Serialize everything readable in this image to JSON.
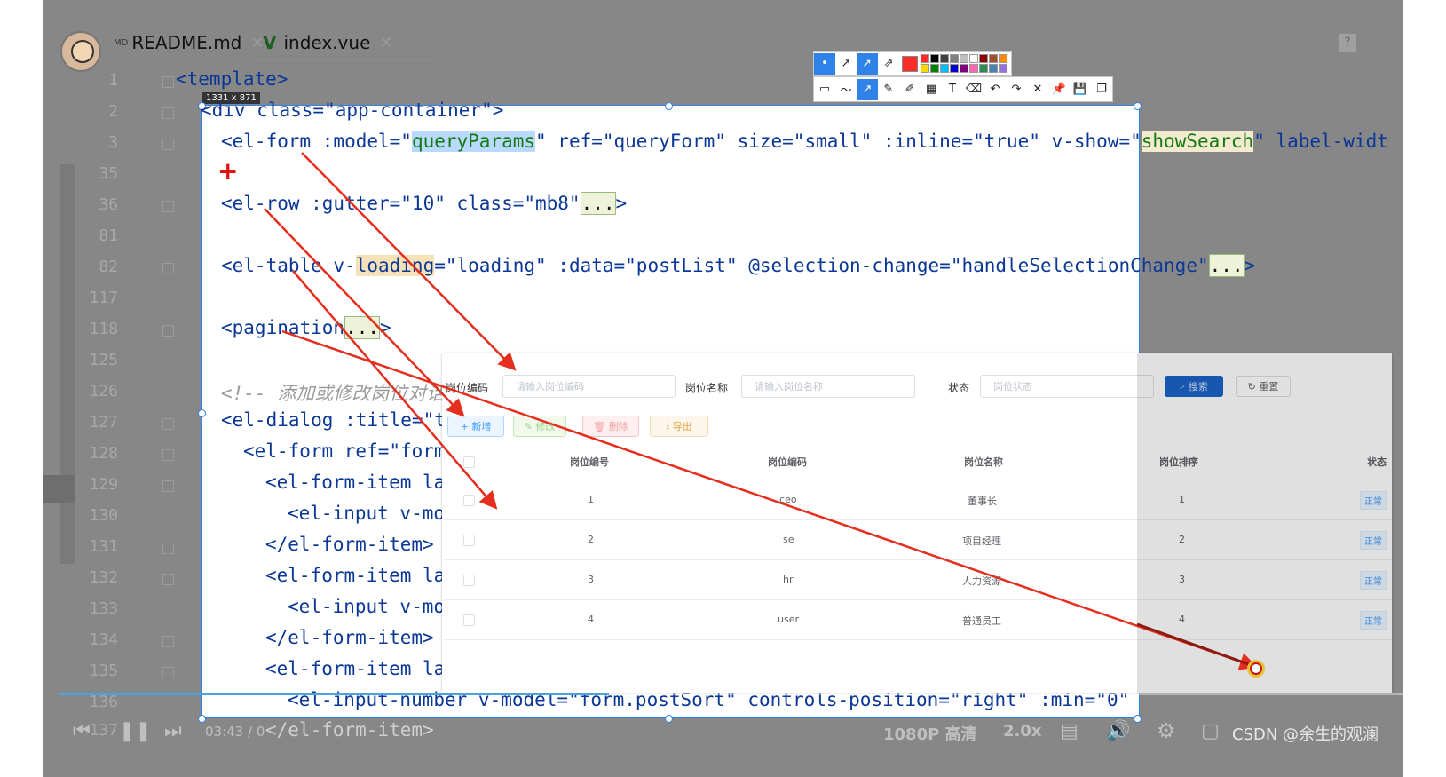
{
  "tabs": [
    {
      "label": "README.md",
      "icon": "markdown-icon",
      "badge": "MD"
    },
    {
      "label": "index.vue",
      "icon": "vue-icon"
    }
  ],
  "help_icon_label": "?",
  "size_badge": "1331 x 871",
  "line_numbers": [
    "1",
    "2",
    "3",
    "35",
    "36",
    "81",
    "82",
    "117",
    "118",
    "125",
    "126",
    "127",
    "128",
    "129",
    "130",
    "131",
    "132",
    "133",
    "134",
    "135",
    "136",
    "137"
  ],
  "code": {
    "l1": "<template>",
    "l2": "<div class=\"app-container\">",
    "l3a": "<el-form :model=\"",
    "l3b": "queryParams",
    "l3c": "\" ref=\"queryForm\" size=\"small\" :inline=\"true\" v-show=\"",
    "l3d": "showSearch",
    "l3e": "\" label-widt",
    "l36a": "<el-row :gutter=\"10\" class=\"mb8\"",
    "l36b": "...",
    "l36c": ">",
    "l82a": "<el-table v-",
    "l82b": "loading",
    "l82c": "=\"loading\" :data=\"postList\" @selection-change=\"handleSelectionChange\"",
    "l82d": "...",
    "l82e": ">",
    "l118a": "<pagination",
    "l118b": "...",
    "l118c": ">",
    "l126": "<!-- 添加或修改岗位对话",
    "l127": "<el-dialog :title=\"t",
    "l128": "<el-form ref=\"form",
    "l129": "<el-form-item la",
    "l130": "<el-input v-mo",
    "l131": "</el-form-item>",
    "l132": "<el-form-item la",
    "l133": "<el-input v-mo",
    "l134": "</el-form-item>",
    "l135": "<el-form-item la",
    "l136": "<el-input-number v-model=\"form.postSort\" controls-position=\"right\" :min=\"0\" />",
    "l137": "</el-form-item>"
  },
  "toolbar": {
    "colors": [
      "#ff2a2a",
      "#000000",
      "#404040",
      "#808080",
      "#c0c0c0",
      "#ffffff",
      "#8b0000",
      "#a0522d",
      "#ff8c00",
      "#ffd700",
      "#008000",
      "#00bfff",
      "#0000cd",
      "#800080",
      "#ff69b4",
      "#2e8b57",
      "#4682b4",
      "#9370db"
    ],
    "row1_icons": [
      "dot-size-icon",
      "arrow-thin-icon",
      "arrow-thick-icon",
      "arrow-outline-icon"
    ],
    "row2_icons": [
      "rect-icon",
      "line-icon",
      "arrow-icon",
      "pen-icon",
      "marker-icon",
      "mosaic-icon",
      "text-icon",
      "eraser-icon",
      "undo-icon",
      "redo-icon",
      "close-icon",
      "pin-icon",
      "save-icon",
      "copy-icon"
    ],
    "text_glyph": "T"
  },
  "pasted": {
    "form": {
      "post_code_label": "岗位编码",
      "post_code_placeholder": "请输入岗位编码",
      "post_name_label": "岗位名称",
      "post_name_placeholder": "请输入岗位名称",
      "status_label": "状态",
      "status_placeholder": "岗位状态",
      "search_btn": "搜索",
      "reset_btn": "重置"
    },
    "actions": {
      "add": "+ 新增",
      "edit": "修改",
      "delete": "删除",
      "export": "导出"
    },
    "headers": [
      "岗位编号",
      "岗位编码",
      "岗位名称",
      "岗位排序",
      "状态"
    ],
    "rows": [
      {
        "id": "1",
        "code": "ceo",
        "name": "董事长",
        "sort": "1",
        "status": "正常"
      },
      {
        "id": "2",
        "code": "se",
        "name": "项目经理",
        "sort": "2",
        "status": "正常"
      },
      {
        "id": "3",
        "code": "hr",
        "name": "人力资源",
        "sort": "3",
        "status": "正常"
      },
      {
        "id": "4",
        "code": "user",
        "name": "普通员工",
        "sort": "4",
        "status": "正常"
      }
    ]
  },
  "player": {
    "time": "03:43 / 0",
    "quality": "1080P 高清",
    "speed": "2.0x",
    "watermark": "CSDN @余生的观澜"
  }
}
